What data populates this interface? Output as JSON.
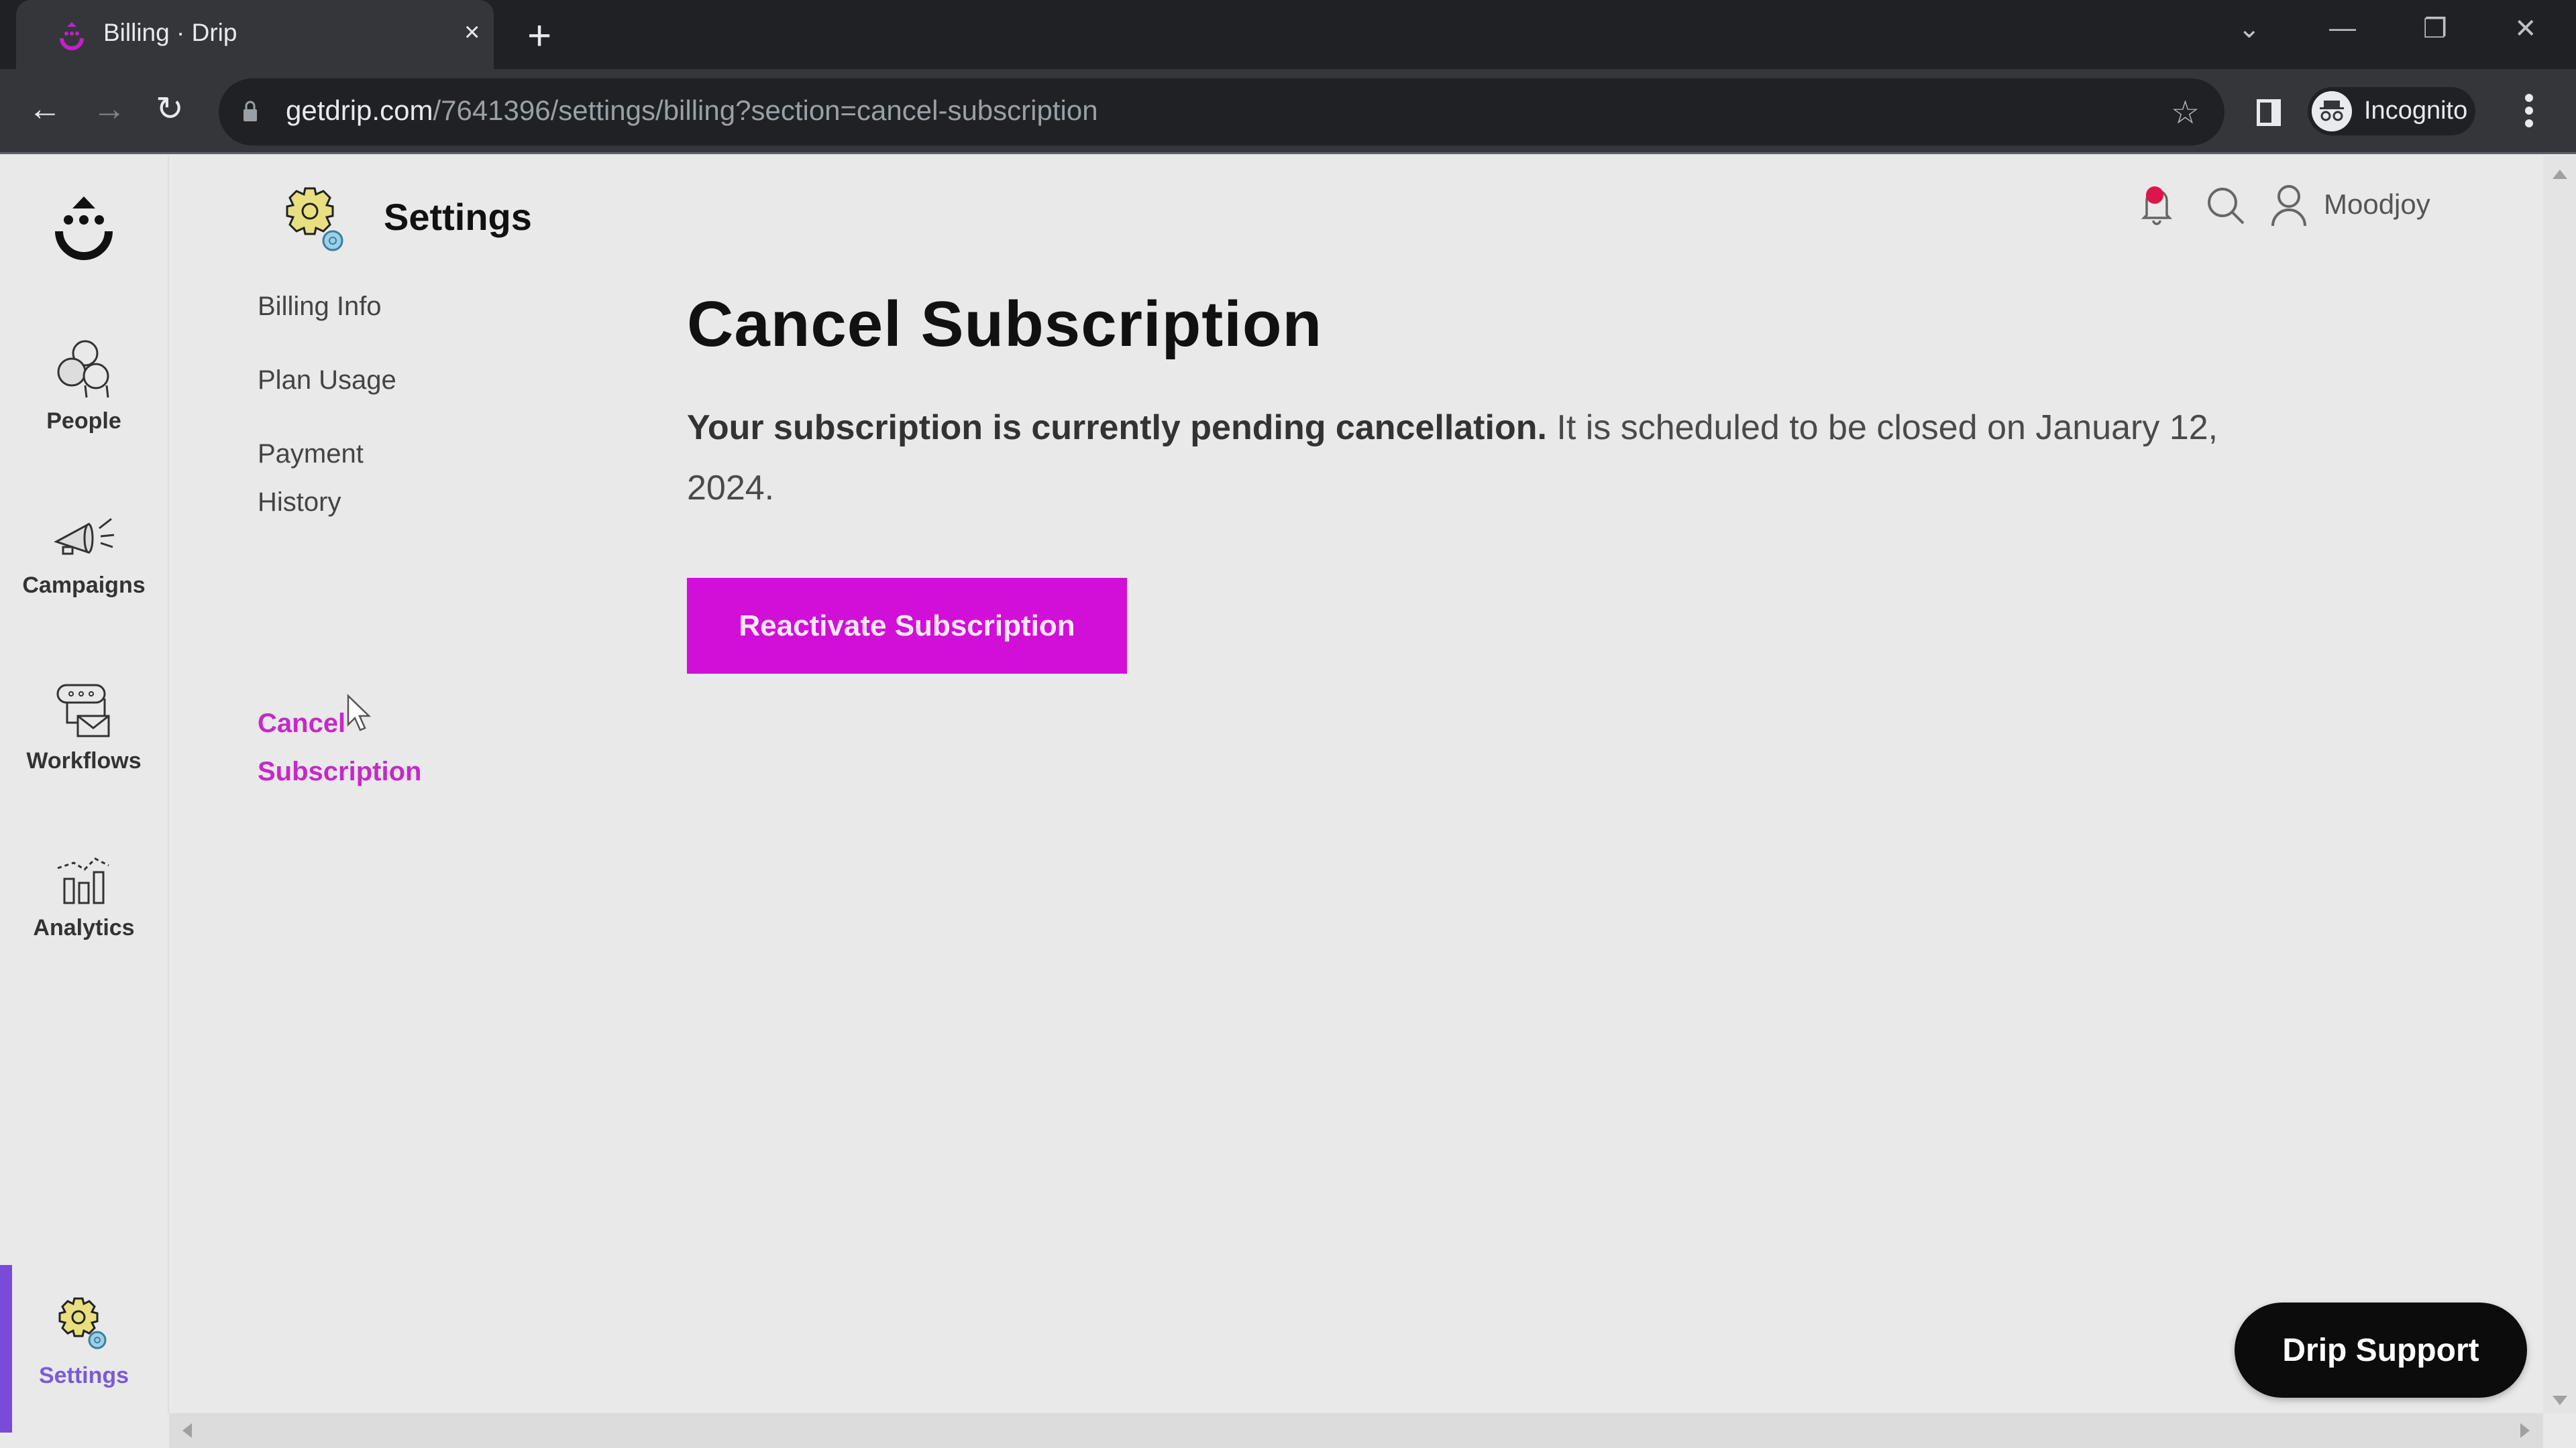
{
  "browser": {
    "tab_title": "Billing · Drip",
    "tab_close": "×",
    "new_tab": "+",
    "url_host": "getdrip.com",
    "url_path": "/7641396/settings/billing?section=cancel-subscription",
    "incognito_label": "Incognito",
    "window_controls": {
      "dropdown": "⌄",
      "minimize": "—",
      "restore": "❐",
      "close": "✕"
    },
    "nav": {
      "back": "←",
      "forward": "→",
      "reload": "↻"
    },
    "star": "☆"
  },
  "sidebar": {
    "items": [
      {
        "label": "People",
        "icon": "people-icon"
      },
      {
        "label": "Campaigns",
        "icon": "megaphone-icon"
      },
      {
        "label": "Workflows",
        "icon": "workflow-icon"
      },
      {
        "label": "Analytics",
        "icon": "analytics-icon"
      },
      {
        "label": "Settings",
        "icon": "gear-icon",
        "active": true
      }
    ],
    "active_color": "#7a4bd8"
  },
  "settings": {
    "title": "Settings",
    "submenu": [
      {
        "label": "Billing Info"
      },
      {
        "label": "Plan Usage"
      },
      {
        "label": "Payment History"
      },
      {
        "label": "Cancel Subscription",
        "active": true
      }
    ]
  },
  "header": {
    "user_name": "Moodjoy",
    "notification_badge_color": "#e0144c"
  },
  "main": {
    "title": "Cancel Subscription",
    "status_bold": "Your subscription is currently pending cancellation.",
    "status_rest": " It is scheduled to be closed on January 12, 2024.",
    "reactivate_label": "Reactivate Subscription",
    "accent_color": "#d10fd6"
  },
  "support": {
    "label": "Drip Support"
  }
}
